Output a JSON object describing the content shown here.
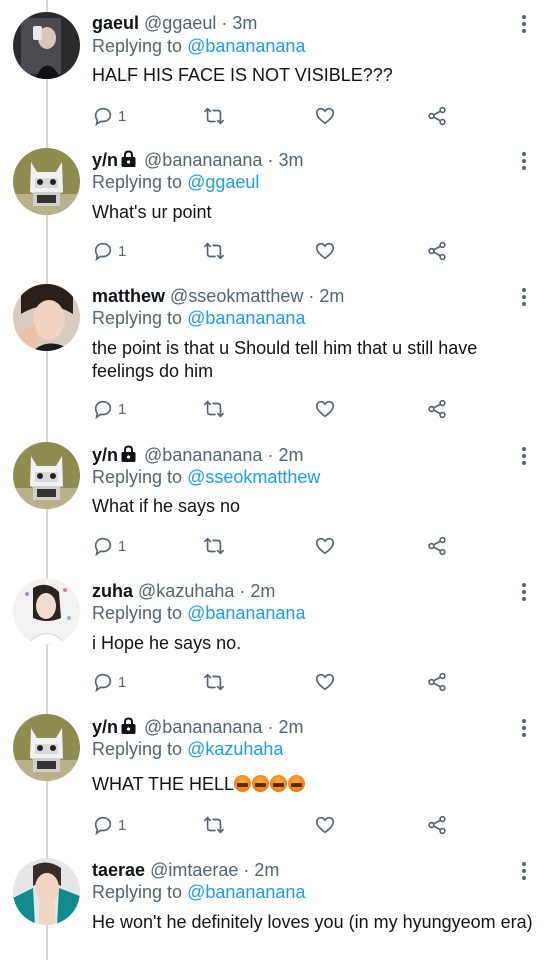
{
  "tweets": [
    {
      "display_name": "gaeul",
      "handle": "@ggaeul",
      "time": "3m",
      "locked": false,
      "replying_prefix": "Replying to",
      "replying_to": "@banananana",
      "text": "HALF HIS FACE IS NOT VISIBLE???",
      "reply_count": "1",
      "avatar": "dark-portrait"
    },
    {
      "display_name": "y/n",
      "handle": "@banananana",
      "time": "3m",
      "locked": true,
      "replying_prefix": "Replying to",
      "replying_to": "@ggaeul",
      "text": "What's ur point",
      "reply_count": "1",
      "avatar": "cat-figurine"
    },
    {
      "display_name": "matthew",
      "handle": "@sseokmatthew",
      "time": "2m",
      "locked": false,
      "replying_prefix": "Replying to",
      "replying_to": "@banananana",
      "text": "the point is that u Should tell him that u still have feelings do him",
      "reply_count": "1",
      "avatar": "selfie-portrait"
    },
    {
      "display_name": "y/n",
      "handle": "@banananana",
      "time": "2m",
      "locked": true,
      "replying_prefix": "Replying to",
      "replying_to": "@sseokmatthew",
      "text": "What if he says no",
      "reply_count": "1",
      "avatar": "cat-figurine"
    },
    {
      "display_name": "zuha",
      "handle": "@kazuhaha",
      "time": "2m",
      "locked": false,
      "replying_prefix": "Replying to",
      "replying_to": "@banananana",
      "text": "i Hope he says no.",
      "reply_count": "1",
      "avatar": "light-portrait"
    },
    {
      "display_name": "y/n",
      "handle": "@banananana",
      "time": "2m",
      "locked": true,
      "replying_prefix": "Replying to",
      "replying_to": "@kazuhaha",
      "text": "WHAT THE HELL",
      "emojis": "🤬🤬🤬🤬",
      "reply_count": "1",
      "avatar": "cat-figurine"
    },
    {
      "display_name": "taerae",
      "handle": "@imtaerae",
      "time": "2m",
      "locked": false,
      "replying_prefix": "Replying to",
      "replying_to": "@banananana",
      "text": "He won't he definitely loves you (in my hyungyeom era)",
      "reply_count": "",
      "avatar": "teal-portrait"
    }
  ],
  "separator": "·",
  "icons": {
    "reply": "reply-icon",
    "retweet": "retweet-icon",
    "like": "heart-icon",
    "share": "share-icon",
    "more": "more-vertical-icon",
    "lock": "lock-icon"
  },
  "colors": {
    "link": "#1d9bf0",
    "muted": "#536471",
    "text": "#0f1419",
    "thread_line": "#cfd9de"
  }
}
